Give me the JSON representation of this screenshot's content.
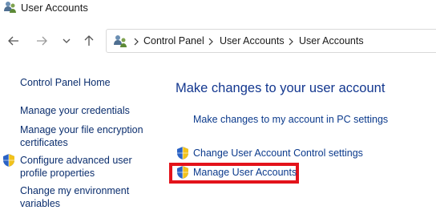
{
  "window": {
    "title": "User Accounts"
  },
  "nav": {
    "back_icon": "back-arrow-icon",
    "forward_icon": "forward-arrow-icon",
    "recent_icon": "chevron-down-icon",
    "up_icon": "up-arrow-icon"
  },
  "address": {
    "crumbs": [
      "Control Panel",
      "User Accounts",
      "User Accounts"
    ]
  },
  "sidebar": {
    "home": "Control Panel Home",
    "items": [
      {
        "label": "Manage your credentials",
        "shield": false
      },
      {
        "label_lines": [
          "Manage your file encryption",
          "certificates"
        ],
        "shield": false
      },
      {
        "label_lines": [
          "Configure advanced user",
          "profile properties"
        ],
        "shield": true
      },
      {
        "label_lines": [
          "Change my environment",
          "variables"
        ],
        "shield": false
      }
    ]
  },
  "main": {
    "heading": "Make changes to your user account",
    "links": [
      {
        "label": "Make changes to my account in PC settings",
        "shield": false
      },
      {
        "label": "Change User Account Control settings",
        "shield": true
      },
      {
        "label": "Manage User Accounts",
        "shield": true,
        "highlighted": true
      }
    ]
  },
  "colors": {
    "link": "#0b3a8c",
    "heading": "#13378f",
    "highlight": "#e3131b"
  }
}
